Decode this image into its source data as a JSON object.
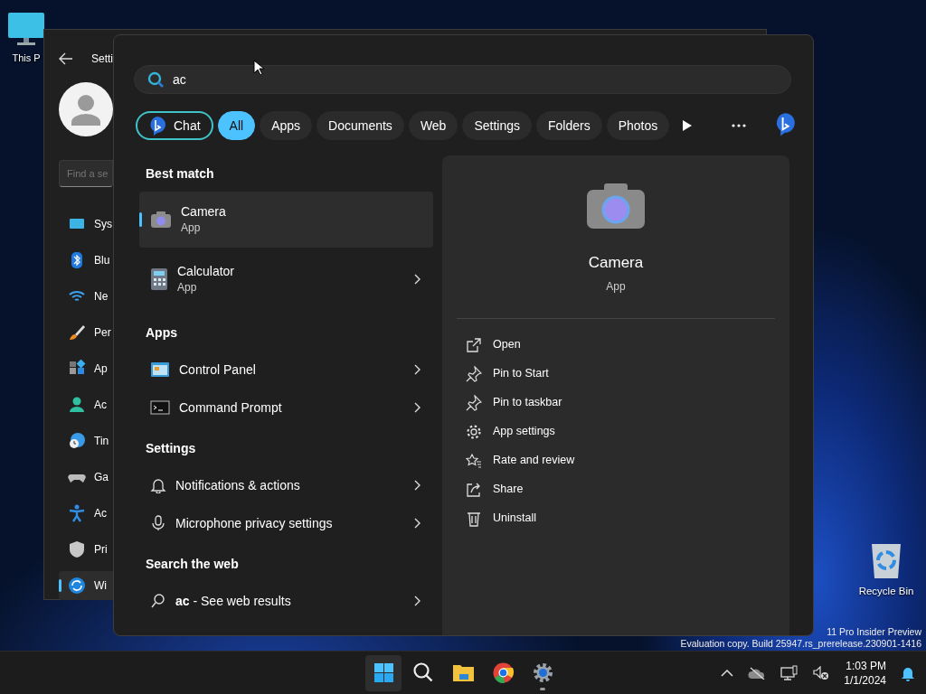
{
  "desktop_icons": [
    {
      "label": "This P"
    },
    {
      "label": "Recycle Bin"
    }
  ],
  "settings_window": {
    "title": "Setti",
    "search_placeholder": "Find a se",
    "nav": [
      {
        "label": "Sys",
        "selected": false
      },
      {
        "label": "Blu",
        "selected": false
      },
      {
        "label": "Ne",
        "selected": false
      },
      {
        "label": "Per",
        "selected": false
      },
      {
        "label": "Ap",
        "selected": false
      },
      {
        "label": "Ac",
        "selected": false
      },
      {
        "label": "Tin",
        "selected": false
      },
      {
        "label": "Ga",
        "selected": false
      },
      {
        "label": "Ac",
        "selected": false
      },
      {
        "label": "Pri",
        "selected": false
      },
      {
        "label": "Wi",
        "selected": true
      }
    ]
  },
  "search": {
    "value": "ac"
  },
  "filters": [
    {
      "label": "Chat",
      "kind": "chat",
      "selected": false
    },
    {
      "label": "All",
      "kind": "chip",
      "selected": true
    },
    {
      "label": "Apps",
      "kind": "chip",
      "selected": false
    },
    {
      "label": "Documents",
      "kind": "chip",
      "selected": false
    },
    {
      "label": "Web",
      "kind": "chip",
      "selected": false
    },
    {
      "label": "Settings",
      "kind": "chip",
      "selected": false
    },
    {
      "label": "Folders",
      "kind": "chip",
      "selected": false
    },
    {
      "label": "Photos",
      "kind": "chip",
      "selected": false
    }
  ],
  "results": [
    {
      "kind": "header",
      "title": "Best match"
    },
    {
      "kind": "item",
      "title": "Camera",
      "subtitle": "App",
      "selected": true
    },
    {
      "kind": "item",
      "title": "Calculator",
      "subtitle": "App",
      "selected": false
    },
    {
      "kind": "header",
      "title": "Apps"
    },
    {
      "kind": "item",
      "title": "Control Panel",
      "selected": false
    },
    {
      "kind": "item",
      "title": "Command Prompt",
      "selected": false
    },
    {
      "kind": "header",
      "title": "Settings"
    },
    {
      "kind": "item",
      "title": "Notifications & actions",
      "selected": false
    },
    {
      "kind": "item",
      "title": "Microphone privacy settings",
      "selected": false
    },
    {
      "kind": "header",
      "title": "Search the web"
    },
    {
      "kind": "item",
      "title": "**ac** - See web results",
      "selected": false
    }
  ],
  "preview": {
    "title": "Camera",
    "subtitle": "App",
    "actions": [
      "Open",
      "Pin to Start",
      "Pin to taskbar",
      "App settings",
      "Rate and review",
      "Share",
      "Uninstall"
    ]
  },
  "system_notice": [
    "11 Pro Insider Preview",
    "Evaluation copy. Build 25947.rs_prerelease.230901-1416"
  ],
  "taskbar": {
    "apps": [
      {
        "kind": "start",
        "selected": true,
        "running": false
      },
      {
        "kind": "search",
        "selected": false,
        "running": false
      },
      {
        "kind": "explorer",
        "selected": false,
        "running": false
      },
      {
        "kind": "chrome",
        "selected": false,
        "running": false
      },
      {
        "kind": "settings",
        "selected": false,
        "running": true
      }
    ]
  },
  "clock": {
    "time": "1:03 PM",
    "date": "1/1/2024"
  }
}
